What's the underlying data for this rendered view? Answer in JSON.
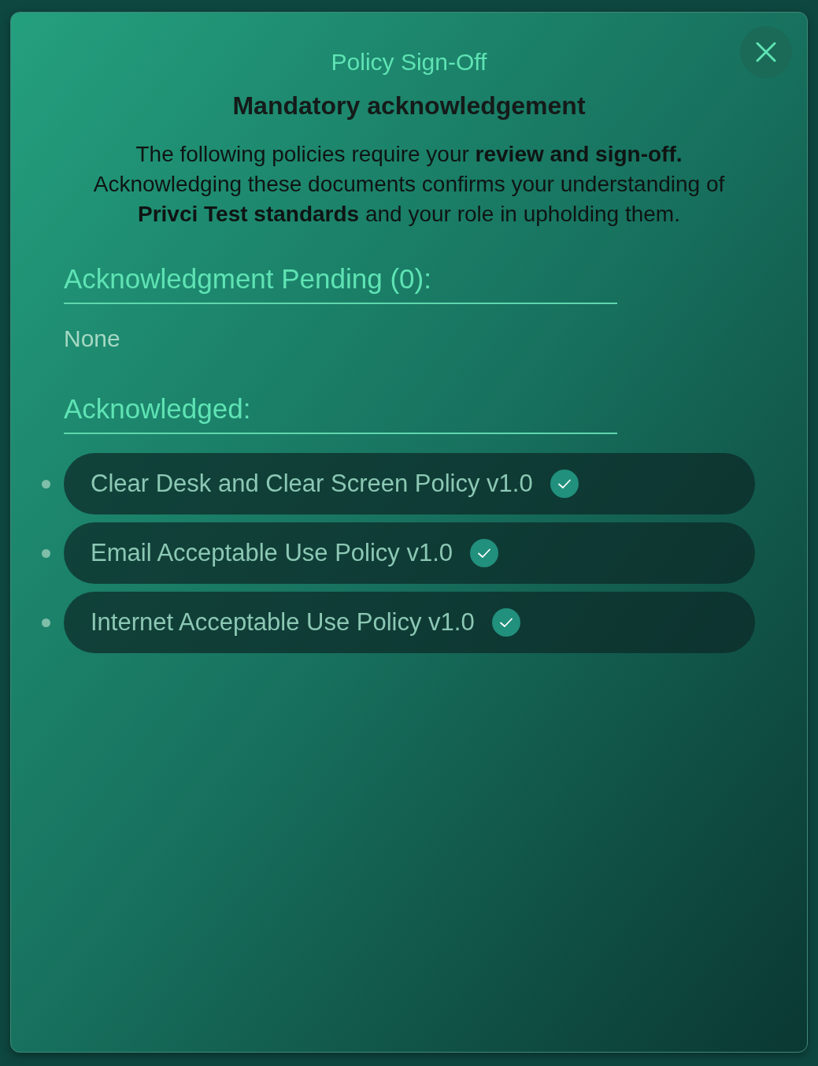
{
  "dialog": {
    "title": "Policy Sign-Off",
    "subtitle": "Mandatory acknowledgement",
    "intro": "The following policies require your **review and sign-off.** Acknowledging these documents confirms your understanding of **Privci Test standards** and your role in upholding them."
  },
  "pending": {
    "heading": "Acknowledgment Pending (0):",
    "empty_text": "None"
  },
  "acknowledged": {
    "heading": "Acknowledged:",
    "items": [
      {
        "label": "Clear Desk and Clear Screen Policy v1.0",
        "acknowledged": true
      },
      {
        "label": "Email Acceptable Use Policy v1.0",
        "acknowledged": true
      },
      {
        "label": "Internet Acceptable Use Policy v1.0",
        "acknowledged": true
      }
    ]
  }
}
